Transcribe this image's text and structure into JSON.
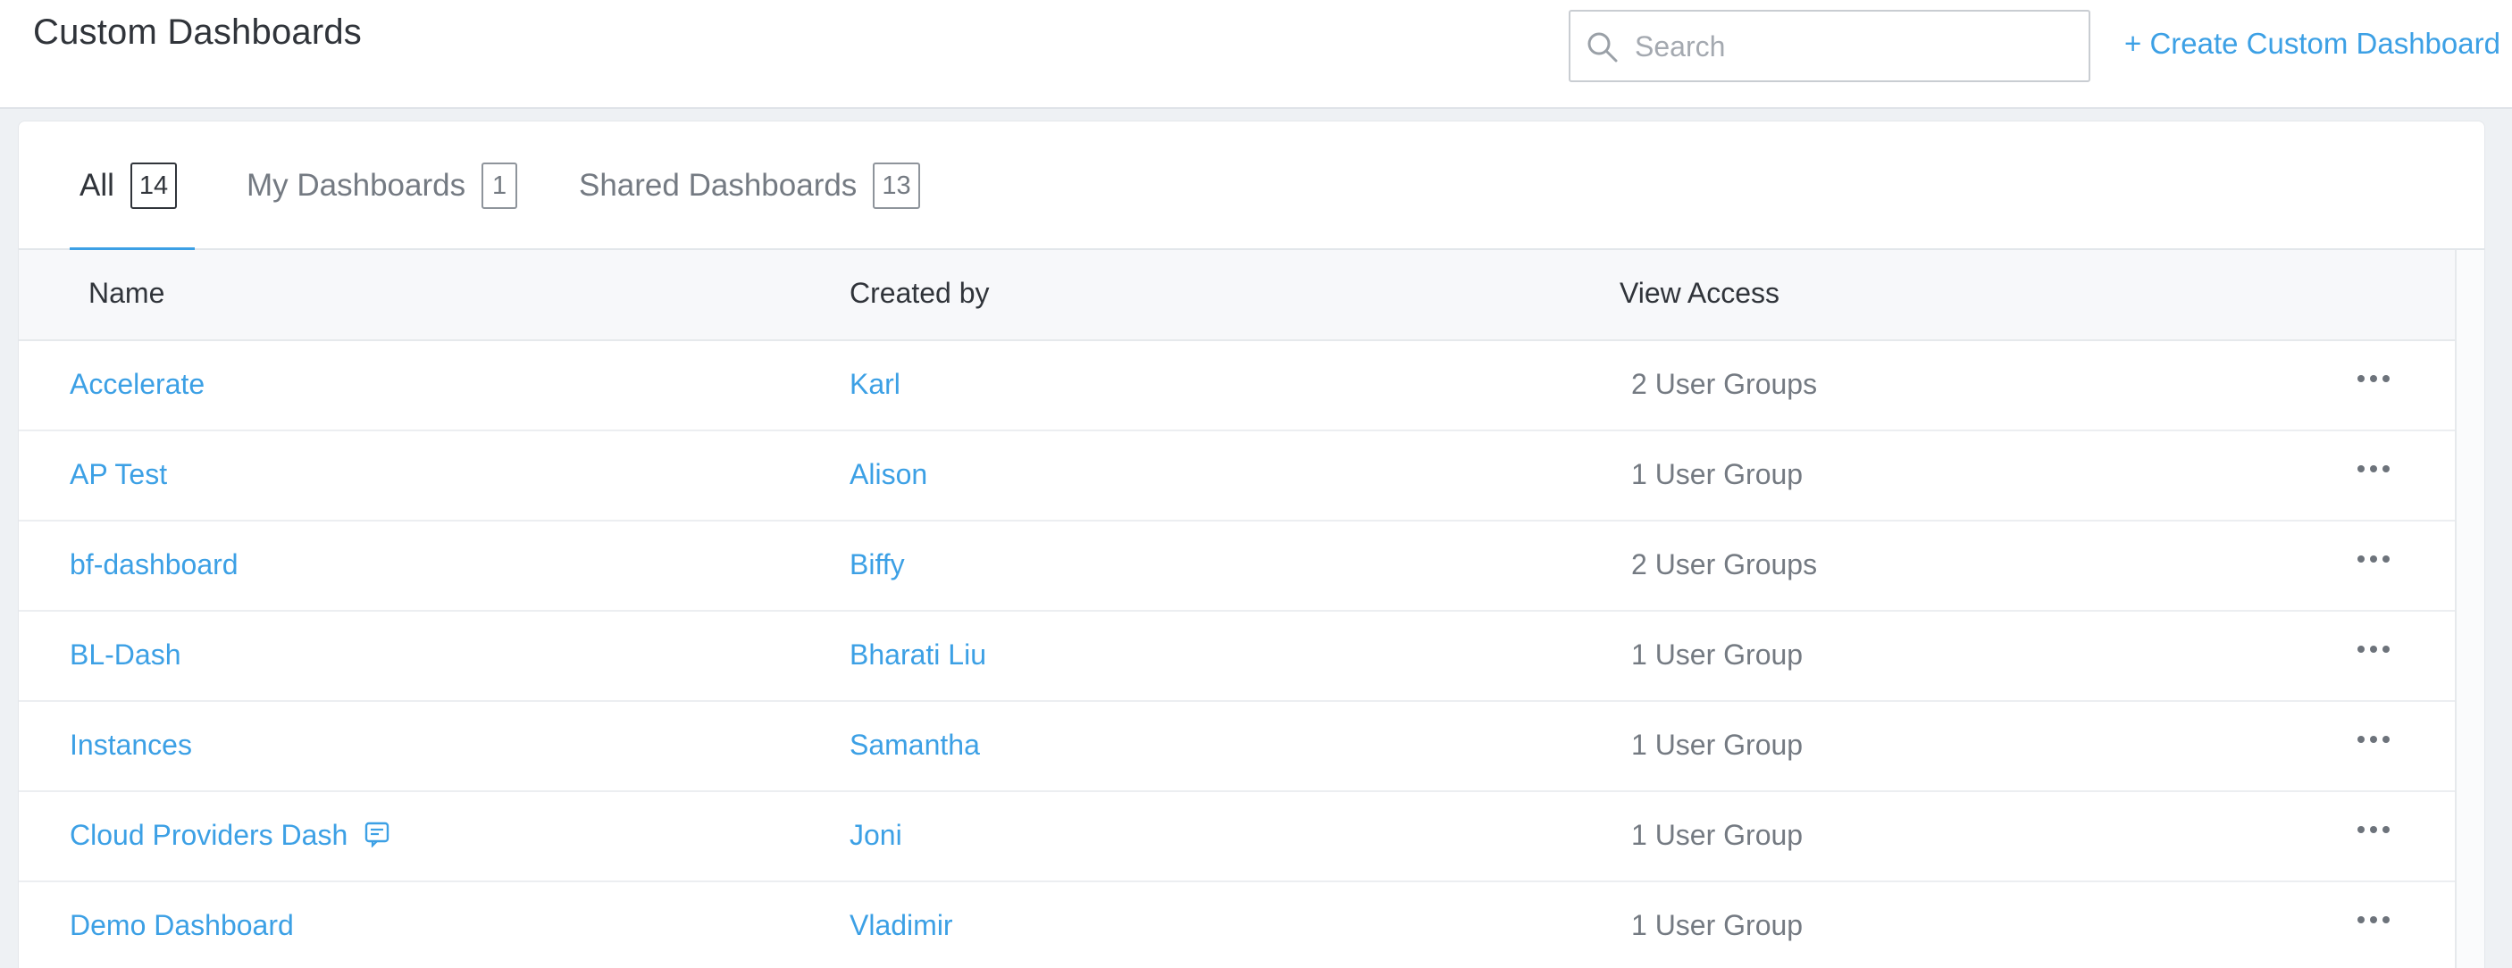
{
  "header": {
    "title": "Custom Dashboards",
    "search_placeholder": "Search",
    "create_label": "+ Create Custom Dashboard"
  },
  "tabs": [
    {
      "label": "All",
      "count": "14",
      "active": true
    },
    {
      "label": "My Dashboards",
      "count": "1",
      "active": false
    },
    {
      "label": "Shared Dashboards",
      "count": "13",
      "active": false
    }
  ],
  "table": {
    "columns": [
      "Name",
      "Created by",
      "View Access"
    ],
    "rows": [
      {
        "name": "Accelerate",
        "created_by": "Karl",
        "access": "2 User Groups",
        "note": false
      },
      {
        "name": "AP Test",
        "created_by": "Alison",
        "access": "1 User Group",
        "note": false
      },
      {
        "name": "bf-dashboard",
        "created_by": "Biffy",
        "access": "2 User Groups",
        "note": false
      },
      {
        "name": "BL-Dash",
        "created_by": "Bharati Liu",
        "access": "1 User Group",
        "note": false
      },
      {
        "name": "Instances",
        "created_by": "Samantha",
        "access": "1 User Group",
        "note": false
      },
      {
        "name": "Cloud Providers Dash",
        "created_by": "Joni",
        "access": "1 User Group",
        "note": true
      },
      {
        "name": "Demo Dashboard",
        "created_by": "Vladimir",
        "access": "1 User Group",
        "note": false
      }
    ]
  },
  "icons": {
    "search": "search-icon",
    "note": "note-icon",
    "more": "more-options-icon"
  },
  "colors": {
    "accent": "#3ca0e5",
    "text": "#30343a",
    "muted": "#747a82"
  }
}
